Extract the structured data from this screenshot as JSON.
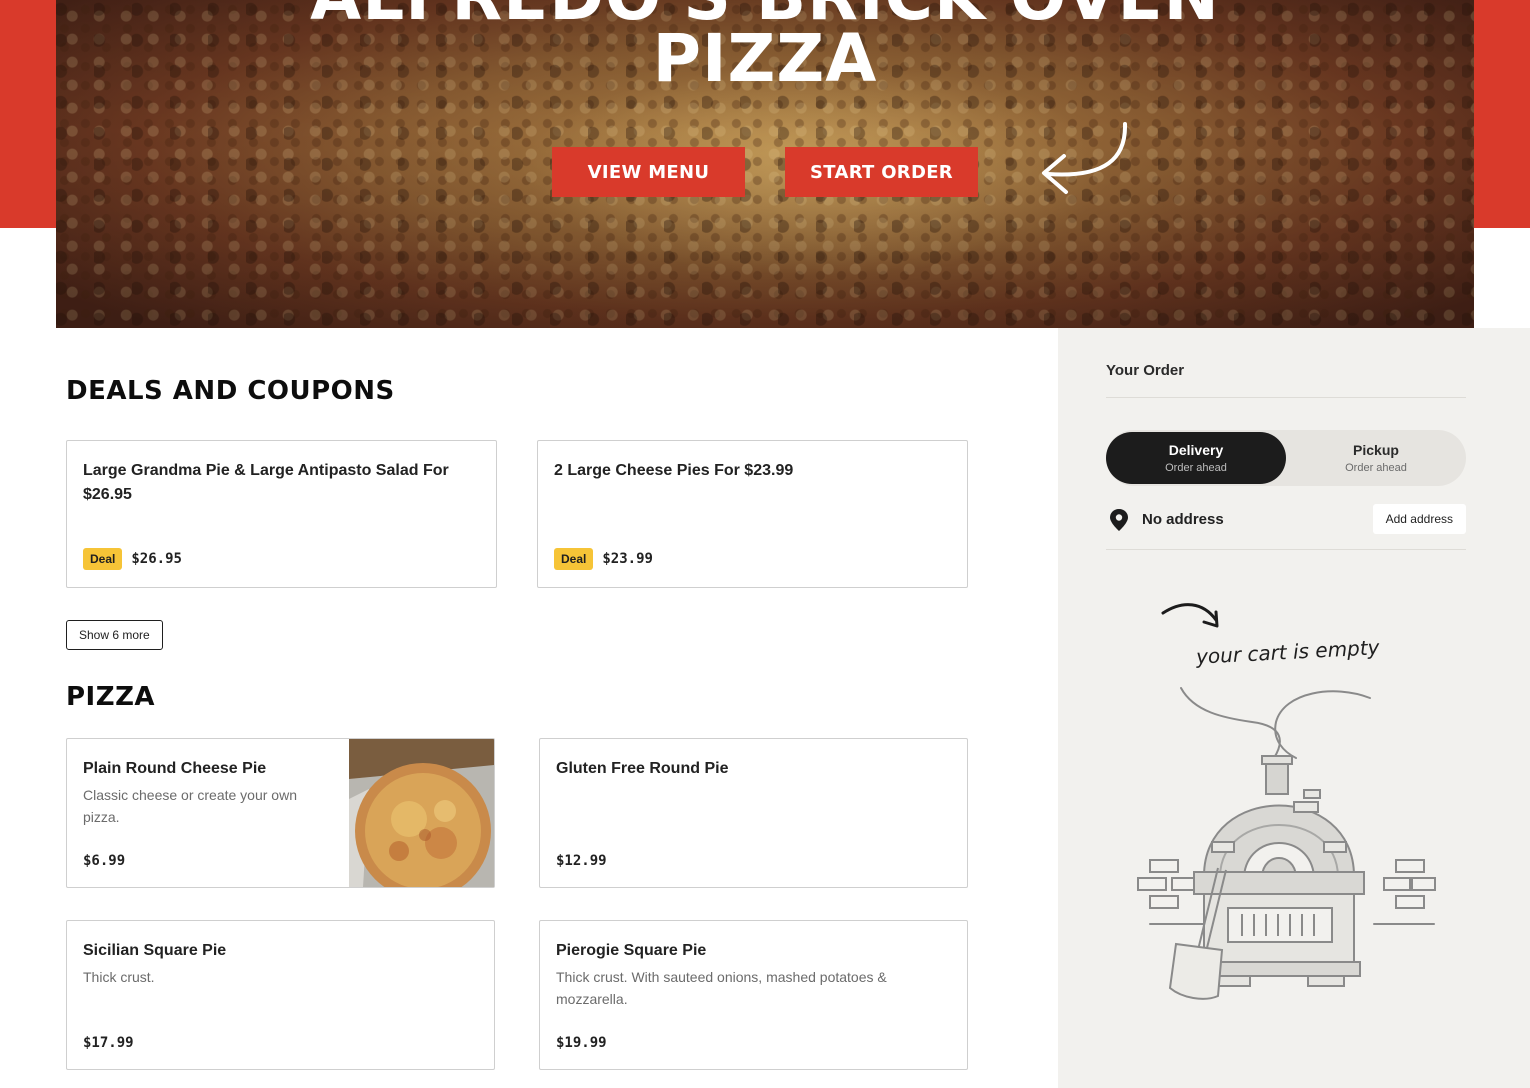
{
  "hero": {
    "title_line1": "ALFREDO'S BRICK OVEN",
    "title_line2": "PIZZA",
    "view_menu_label": "VIEW MENU",
    "start_order_label": "START ORDER"
  },
  "deals": {
    "heading": "DEALS AND COUPONS",
    "items": [
      {
        "title_line1": "Large Grandma Pie & Large Antipasto Salad For",
        "title_line2": "$26.95",
        "badge": "Deal",
        "price": "$26.95"
      },
      {
        "title_line1": "2 Large Cheese Pies For $23.99",
        "title_line2": "",
        "badge": "Deal",
        "price": "$23.99"
      }
    ],
    "show_more_label": "Show 6 more"
  },
  "pizza": {
    "heading": "PIZZA",
    "items": [
      {
        "name": "Plain Round Cheese Pie",
        "desc_line1": "Classic cheese or create your own",
        "desc_line2": "pizza.",
        "price": "$6.99"
      },
      {
        "name": "Gluten Free Round Pie",
        "desc_line1": "",
        "desc_line2": "",
        "price": "$12.99"
      },
      {
        "name": "Sicilian Square Pie",
        "desc_line1": "Thick crust.",
        "desc_line2": "",
        "price": "$17.99"
      },
      {
        "name": "Pierogie Square Pie",
        "desc_line1": "Thick crust. With sauteed onions, mashed potatoes &",
        "desc_line2": "mozzarella.",
        "price": "$19.99"
      }
    ]
  },
  "sidebar": {
    "title": "Your Order",
    "delivery_label": "Delivery",
    "delivery_sub": "Order ahead",
    "pickup_label": "Pickup",
    "pickup_sub": "Order ahead",
    "address_text": "No address",
    "add_address_label": "Add address",
    "empty_cart_text": "your cart is empty"
  },
  "colors": {
    "brand_red": "#d93a2b",
    "deal_yellow": "#f6c437",
    "sidebar_bg": "#f2f1ee",
    "toggle_active": "#1c1c1c"
  },
  "icons": [
    "curved-arrow-icon",
    "location-pin-icon",
    "hand-drawn-arrow-icon",
    "brick-oven-illustration"
  ]
}
